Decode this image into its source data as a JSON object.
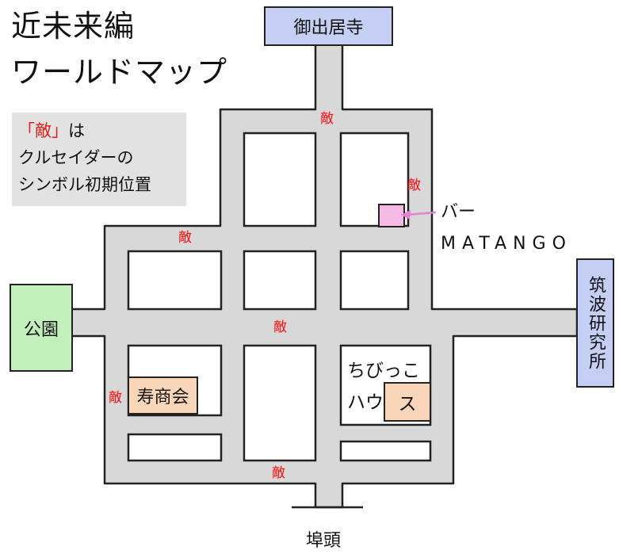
{
  "title": {
    "line1": "近未来編",
    "line2": "ワールドマップ"
  },
  "legend": {
    "enemy_label": "「敵」",
    "line1_suffix": "は",
    "line2": "クルセイダーの",
    "line3": "シンボル初期位置"
  },
  "locations": {
    "temple": "御出居寺",
    "park": "公園",
    "institute": "筑波研究所",
    "wharf": "埠頭",
    "kotobuki": "寿商会",
    "chibikko_line1": "ちびっこ",
    "chibikko_line2": "ハウ",
    "chibikko_box": "ス",
    "bar_line1": "バー",
    "bar_line2": "MATANGO"
  },
  "enemies": [
    "敵",
    "敵",
    "敵",
    "敵",
    "敵"
  ],
  "colors": {
    "road": "#d8d8d8",
    "outline": "#222222",
    "enemy": "#ff1010",
    "temple_fill": "#c5cff4",
    "park_fill": "#c2f0bb",
    "shop_fill": "#fad6b9",
    "bar_fill": "#f6b9e6",
    "bar_arrow": "#e880d0",
    "legend_bg": "#e2e2e2"
  }
}
